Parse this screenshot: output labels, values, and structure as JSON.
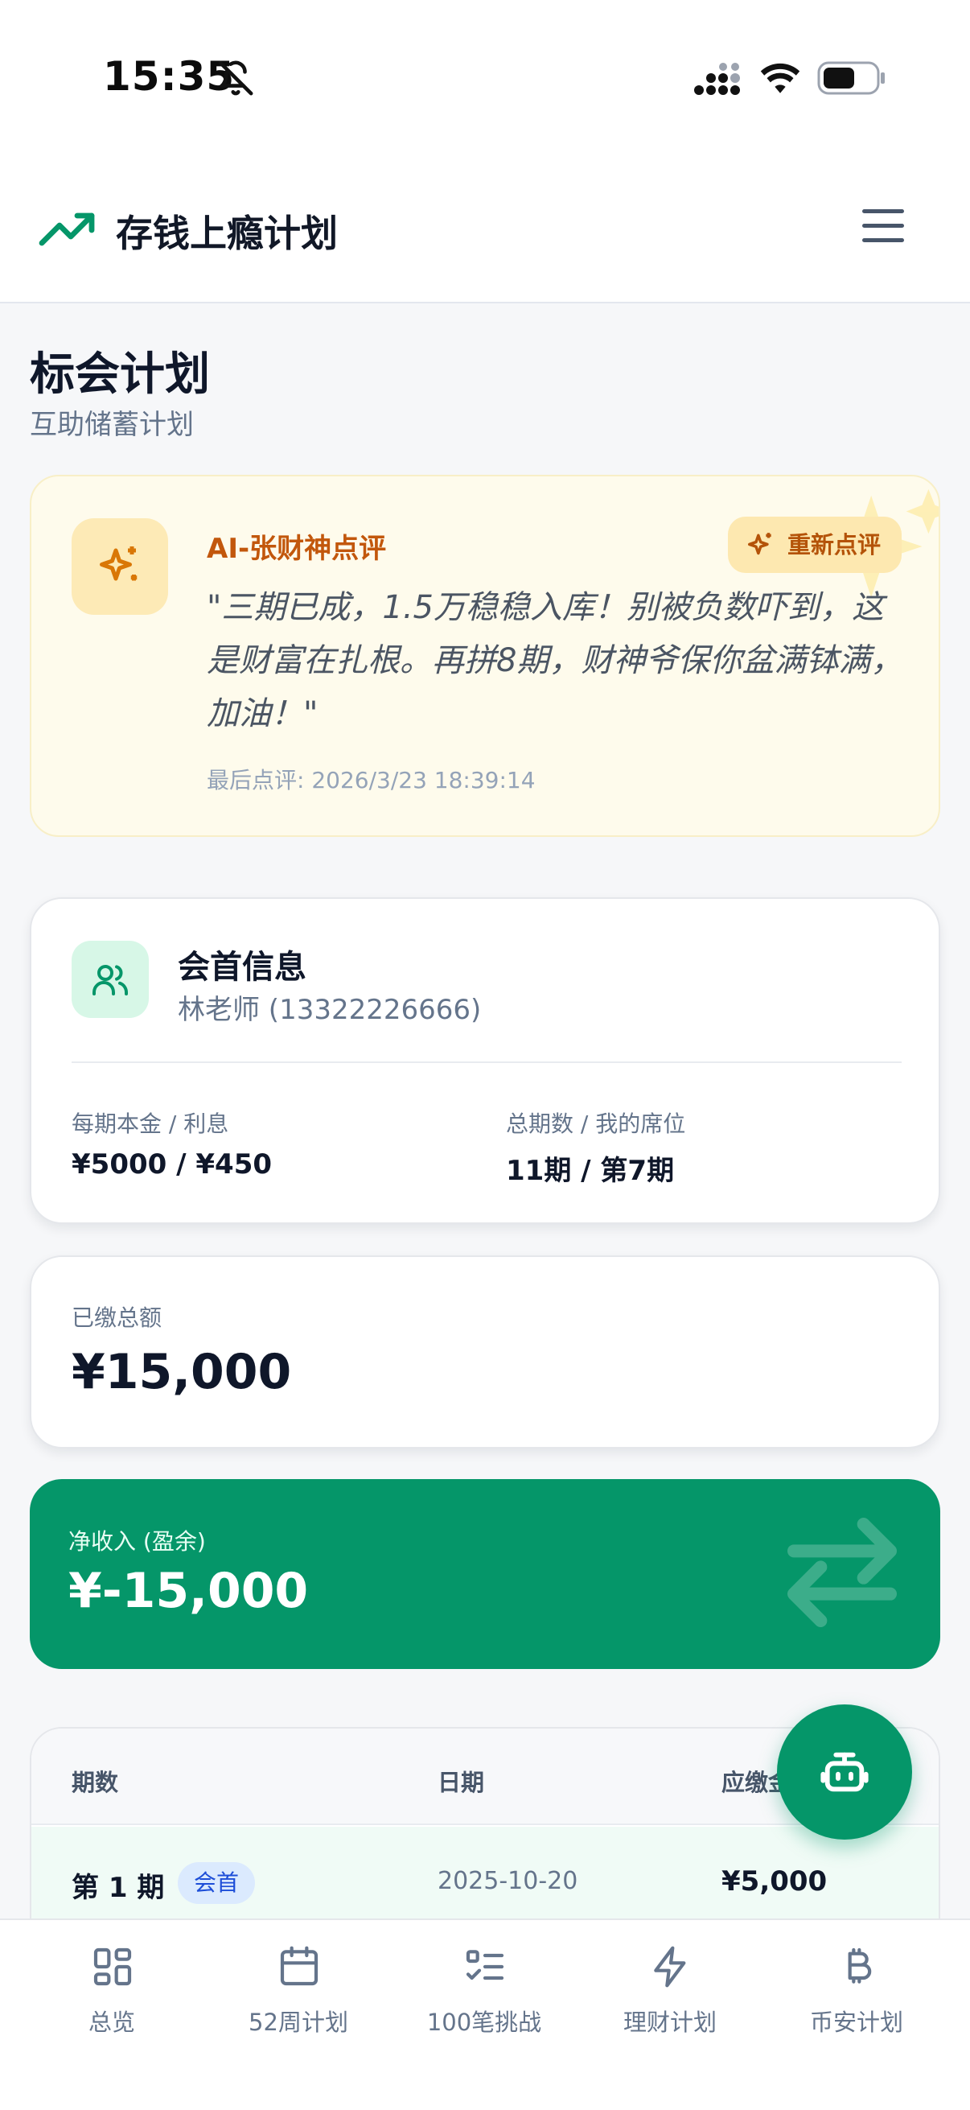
{
  "status_bar": {
    "time": "15:35",
    "icons": [
      "bell-slash-icon",
      "signal-icon",
      "wifi-icon",
      "battery-icon"
    ]
  },
  "header": {
    "title": "存钱上瘾计划",
    "logo_icon": "trending-up-icon",
    "menu_icon": "hamburger-menu-icon"
  },
  "page": {
    "title": "标会计划",
    "subtitle": "互助储蓄计划"
  },
  "ai_review": {
    "heading": "AI-张财神点评",
    "refresh_label": "重新点评",
    "quote": "\"三期已成，1.5万稳稳入库！别被负数吓到，这是财富在扎根。再拼8期，财神爷保你盆满钵满，加油！\"",
    "last_review": "最后点评: 2026/3/23 18:39:14",
    "icon": "sparkles-icon"
  },
  "leader": {
    "title": "会首信息",
    "person": "林老师 (13322226666)",
    "icon": "users-icon",
    "stats": [
      {
        "label": "每期本金 / 利息",
        "value": "¥5000 / ¥450"
      },
      {
        "label": "总期数 / 我的席位",
        "value": "11期 / 第7期"
      }
    ]
  },
  "paid": {
    "label": "已缴总额",
    "value": "¥15,000"
  },
  "net_income": {
    "label": "净收入 (盈余)",
    "value": "¥-15,000",
    "icon": "arrows-exchange-icon"
  },
  "table": {
    "headers": [
      "期数",
      "日期",
      "应缴金"
    ],
    "rows": [
      {
        "period": "第 1 期",
        "badge": "会首",
        "date": "2025-10-20",
        "amount": "¥5,000"
      }
    ]
  },
  "fab": {
    "icon": "bot-icon"
  },
  "bottom_nav": [
    {
      "label": "总览",
      "icon": "dashboard-grid-icon"
    },
    {
      "label": "52周计划",
      "icon": "calendar-icon"
    },
    {
      "label": "100笔挑战",
      "icon": "checklist-icon"
    },
    {
      "label": "理财计划",
      "icon": "lightning-icon"
    },
    {
      "label": "币安计划",
      "icon": "bitcoin-icon"
    }
  ],
  "colors": {
    "accent_green": "#059669",
    "ai_orange": "#c2570c",
    "ai_bg": "#fefbec",
    "badge_blue": "#1d4ed8"
  }
}
